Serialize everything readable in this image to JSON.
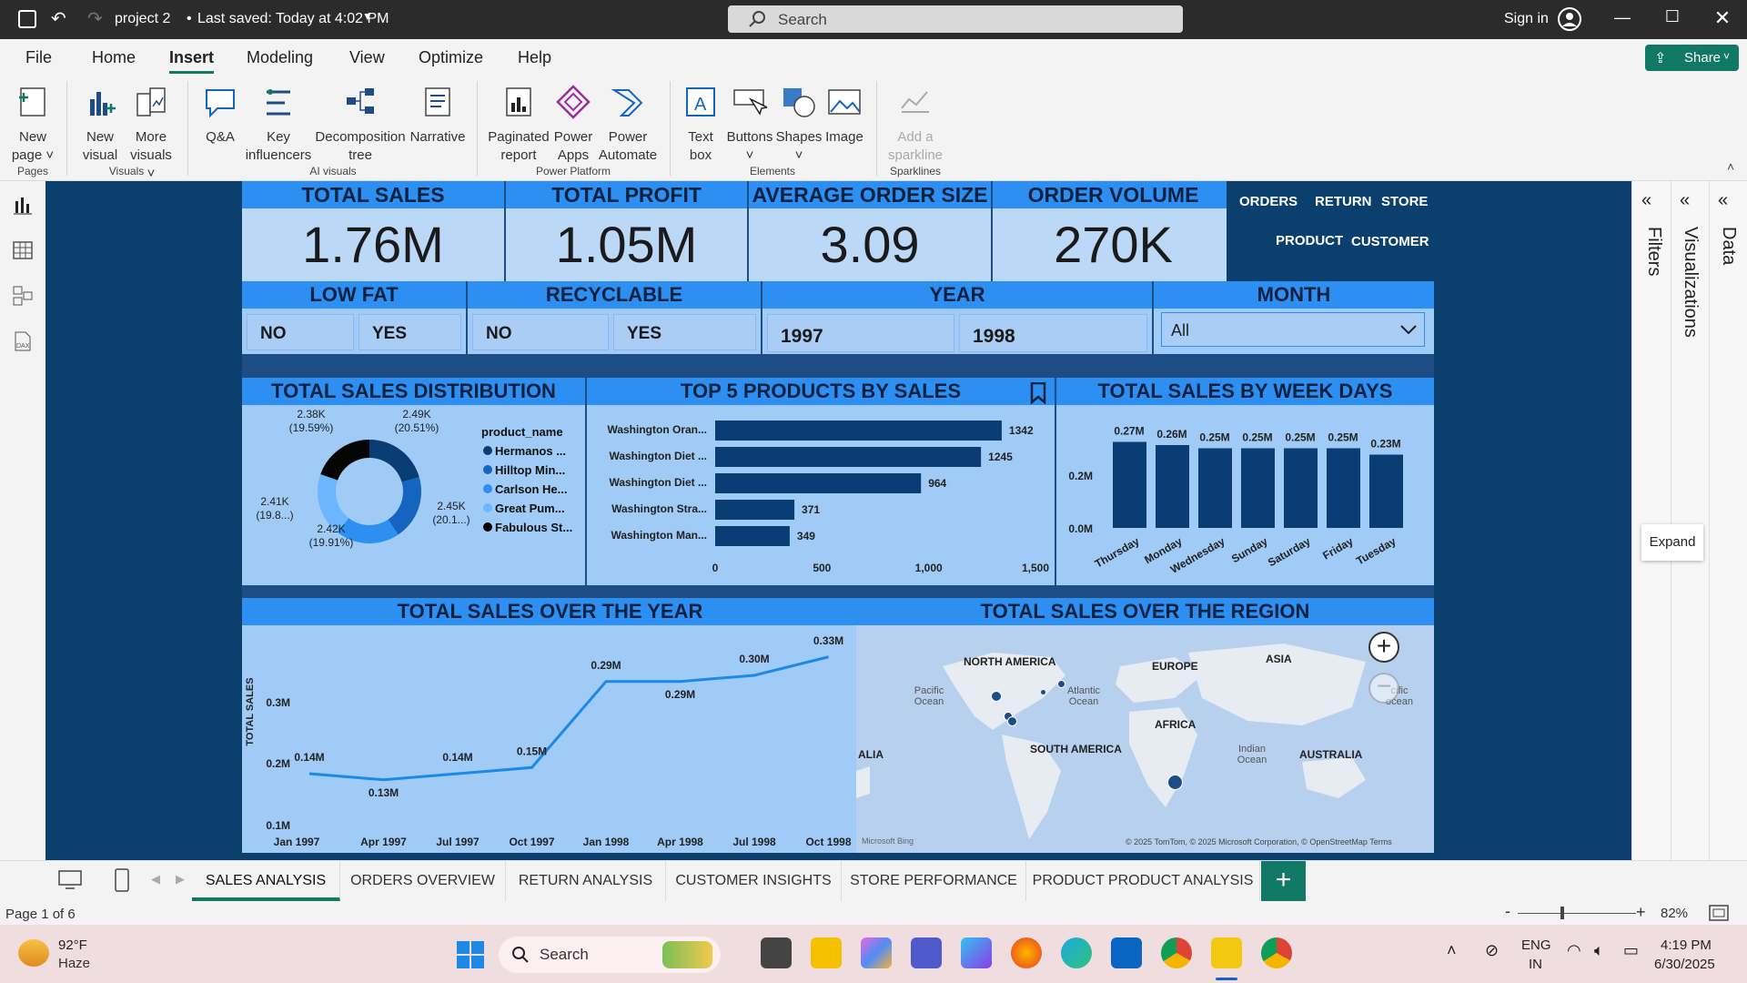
{
  "titlebar": {
    "file_title": "project 2",
    "saved": "Last saved: Today at 4:02 PM",
    "search_placeholder": "Search",
    "sign_in": "Sign in"
  },
  "menu": [
    "File",
    "Home",
    "Insert",
    "Modeling",
    "View",
    "Optimize",
    "Help"
  ],
  "share": "Share",
  "ribbon": {
    "buttons": [
      {
        "l1": "New",
        "l2": "page ˅"
      },
      {
        "l1": "New",
        "l2": "visual"
      },
      {
        "l1": "More",
        "l2": "visuals ˅"
      },
      {
        "l1": "Q&A",
        "l2": ""
      },
      {
        "l1": "Key",
        "l2": "influencers"
      },
      {
        "l1": "Decomposition",
        "l2": "tree"
      },
      {
        "l1": "Narrative",
        "l2": ""
      },
      {
        "l1": "Paginated",
        "l2": "report"
      },
      {
        "l1": "Power",
        "l2": "Apps"
      },
      {
        "l1": "Power",
        "l2": "Automate"
      },
      {
        "l1": "Text",
        "l2": "box"
      },
      {
        "l1": "Buttons",
        "l2": "˅"
      },
      {
        "l1": "Shapes",
        "l2": "˅"
      },
      {
        "l1": "Image",
        "l2": ""
      },
      {
        "l1": "Add a",
        "l2": "sparkline"
      }
    ],
    "groups": [
      "Pages",
      "Visuals",
      "AI visuals",
      "Power Platform",
      "Elements",
      "Sparklines"
    ]
  },
  "right_panes": {
    "filters": "Filters",
    "visualizations": "Visualizations",
    "data": "Data",
    "expand_tooltip": "Expand"
  },
  "kpis": [
    {
      "label": "TOTAL SALES",
      "value": "1.76M"
    },
    {
      "label": "TOTAL PROFIT",
      "value": "1.05M"
    },
    {
      "label": "AVERAGE ORDER SIZE",
      "value": "3.09"
    },
    {
      "label": "ORDER VOLUME",
      "value": "270K"
    }
  ],
  "nav_links": [
    "ORDERS",
    "RETURN",
    "STORE",
    "PRODUCT",
    "CUSTOMER"
  ],
  "slicers": {
    "low_fat": {
      "title": "LOW FAT",
      "options": [
        "NO",
        "YES"
      ]
    },
    "recyclable": {
      "title": "RECYCLABLE",
      "options": [
        "NO",
        "YES"
      ]
    },
    "year": {
      "title": "YEAR",
      "options": [
        "1997",
        "1998"
      ]
    },
    "month": {
      "title": "MONTH",
      "selected": "All"
    }
  },
  "donut": {
    "title": "TOTAL SALES DISTRIBUTION",
    "legend_title": "product_name",
    "labels": [
      {
        "v": "2.38K",
        "p": "(19.59%)"
      },
      {
        "v": "2.49K",
        "p": "(20.51%)"
      },
      {
        "v": "2.45K",
        "p": "(20.1...)"
      },
      {
        "v": "2.42K",
        "p": "(19.91%)"
      },
      {
        "v": "2.41K",
        "p": "(19.8...)"
      }
    ]
  },
  "bar_products": {
    "title": "TOP 5 PRODUCTS BY SALES"
  },
  "weekdays": {
    "title": "TOTAL SALES BY WEEK DAYS"
  },
  "line": {
    "title": "TOTAL SALES OVER THE YEAR"
  },
  "map": {
    "title": "TOTAL SALES OVER THE REGION",
    "labels": [
      {
        "t": "NORTH AMERICA"
      },
      {
        "t": "EUROPE"
      },
      {
        "t": "ASIA"
      },
      {
        "t": "AFRICA"
      },
      {
        "t": "SOUTH AMERICA"
      },
      {
        "t": "AUSTRALIA"
      },
      {
        "t": "ALIA"
      },
      {
        "t": "Pacific Ocean"
      },
      {
        "t": "Atlantic Ocean"
      },
      {
        "t": "Indian Ocean"
      },
      {
        "t": "cific ocean"
      }
    ],
    "attribution": "© 2025 TomTom, © 2025 Microsoft Corporation, © OpenStreetMap  Terms",
    "bing": "Microsoft Bing"
  },
  "tabs": [
    "SALES ANALYSIS",
    "ORDERS OVERVIEW",
    "RETURN ANALYSIS",
    "CUSTOMER INSIGHTS",
    "STORE PERFORMANCE",
    "PRODUCT PRODUCT ANALYSIS"
  ],
  "status": {
    "page": "Page 1 of 6",
    "zoom": "82%"
  },
  "taskbar": {
    "temp": "92°F",
    "weather": "Haze",
    "search": "Search",
    "lang1": "ENG",
    "lang2": "IN",
    "time": "4:19 PM",
    "date": "6/30/2025"
  },
  "colors": {
    "accent": "#117865",
    "dark_blue": "#0b3f6e",
    "header_blue": "#2c8ff1",
    "bar_blue": "#0a3d73",
    "light_blue": "#a9cdf5"
  },
  "chart_data": [
    {
      "type": "pie",
      "title": "TOTAL SALES DISTRIBUTION",
      "legend_title": "product_name",
      "categories": [
        "Hermanos ...",
        "Hilltop Min...",
        "Carlson He...",
        "Great Pum...",
        "Fabulous St..."
      ],
      "values": [
        2.49,
        2.45,
        2.42,
        2.41,
        2.38
      ],
      "colors": [
        "#0a3d73",
        "#1565c0",
        "#2c8ff1",
        "#6cb6ff",
        "#050505"
      ]
    },
    {
      "type": "bar",
      "orientation": "horizontal",
      "title": "TOP 5 PRODUCTS BY SALES",
      "categories": [
        "Washington Oran...",
        "Washington Diet ...",
        "Washington Diet ...",
        "Washington Stra...",
        "Washington Man..."
      ],
      "values": [
        1342,
        1245,
        964,
        371,
        349
      ],
      "xlim": [
        0,
        1500
      ],
      "xticks": [
        "0",
        "500",
        "1,000",
        "1,500"
      ]
    },
    {
      "type": "bar",
      "title": "TOTAL SALES BY WEEK DAYS",
      "categories": [
        "Thursday",
        "Monday",
        "Wednesday",
        "Sunday",
        "Saturday",
        "Friday",
        "Tuesday"
      ],
      "values": [
        0.27,
        0.26,
        0.25,
        0.25,
        0.25,
        0.25,
        0.23
      ],
      "value_labels": [
        "0.27M",
        "0.26M",
        "0.25M",
        "0.25M",
        "0.25M",
        "0.25M",
        "0.23M"
      ],
      "ylim": [
        0,
        0.3
      ],
      "yticks": [
        "0.0M",
        "0.2M"
      ]
    },
    {
      "type": "line",
      "title": "TOTAL SALES OVER THE YEAR",
      "ylabel": "TOTAL SALES",
      "x": [
        "Jan 1997",
        "Apr 1997",
        "Jul 1997",
        "Oct 1997",
        "Jan 1998",
        "Apr 1998",
        "Jul 1998",
        "Oct 1998"
      ],
      "points": [
        {
          "x": "Jan 1997",
          "y": 0.14,
          "label": "0.14M"
        },
        {
          "x": "Apr 1997",
          "y": 0.13,
          "label": "0.13M"
        },
        {
          "x": "Jul 1997",
          "y": 0.14,
          "label": "0.14M"
        },
        {
          "x": "Oct 1997",
          "y": 0.15,
          "label": "0.15M"
        },
        {
          "x": "Jan 1998",
          "y": 0.29,
          "label": "0.29M"
        },
        {
          "x": "Apr 1998",
          "y": 0.29,
          "label": "0.29M"
        },
        {
          "x": "Jul 1998",
          "y": 0.3,
          "label": "0.30M"
        },
        {
          "x": "Oct 1998",
          "y": 0.33,
          "label": "0.33M"
        }
      ],
      "ylim": [
        0.1,
        0.33
      ],
      "yticks": [
        "0.1M",
        "0.2M",
        "0.3M"
      ]
    }
  ]
}
